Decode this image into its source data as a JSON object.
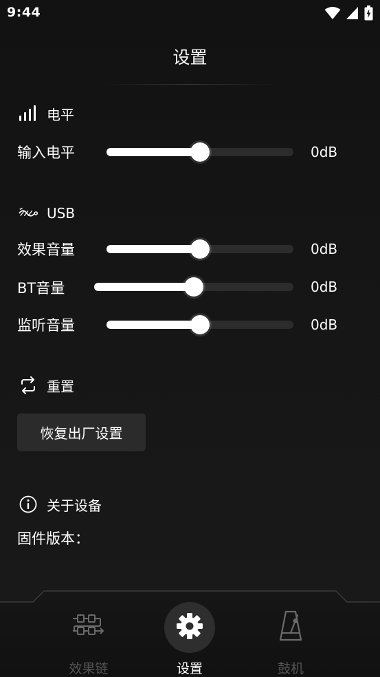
{
  "status_bar": {
    "time": "9:44",
    "icons": [
      "wifi-icon",
      "cellular-signal-icon",
      "battery-charging-icon"
    ]
  },
  "page": {
    "title": "设置"
  },
  "level_section": {
    "header": "电平",
    "icon": "signal-bars-icon",
    "rows": [
      {
        "label": "输入电平",
        "value": "0dB",
        "level_fraction": 0.5
      }
    ]
  },
  "usb_section": {
    "header": "USB",
    "icon": "usb-icon",
    "rows": [
      {
        "label": "效果音量",
        "value": "0dB",
        "level_fraction": 0.5
      },
      {
        "label": "BT音量",
        "value": "0dB",
        "level_fraction": 0.5
      },
      {
        "label": "监听音量",
        "value": "0dB",
        "level_fraction": 0.5
      }
    ]
  },
  "reset_section": {
    "header": "重置",
    "icon": "reset-arrows-icon",
    "button_label": "恢复出厂设置"
  },
  "about_section": {
    "header": "关于设备",
    "icon": "info-icon",
    "firmware_label": "固件版本："
  },
  "nav": {
    "items": [
      {
        "label": "效果链",
        "icon": "effects-chain-icon",
        "active": false
      },
      {
        "label": "设置",
        "icon": "gear-icon",
        "active": true
      },
      {
        "label": "鼓机",
        "icon": "metronome-icon",
        "active": false
      }
    ]
  },
  "colors": {
    "background": "#141414",
    "slider_fill": "#ffffff",
    "slider_track": "#2c2c2c",
    "inactive_nav": "#555555"
  }
}
